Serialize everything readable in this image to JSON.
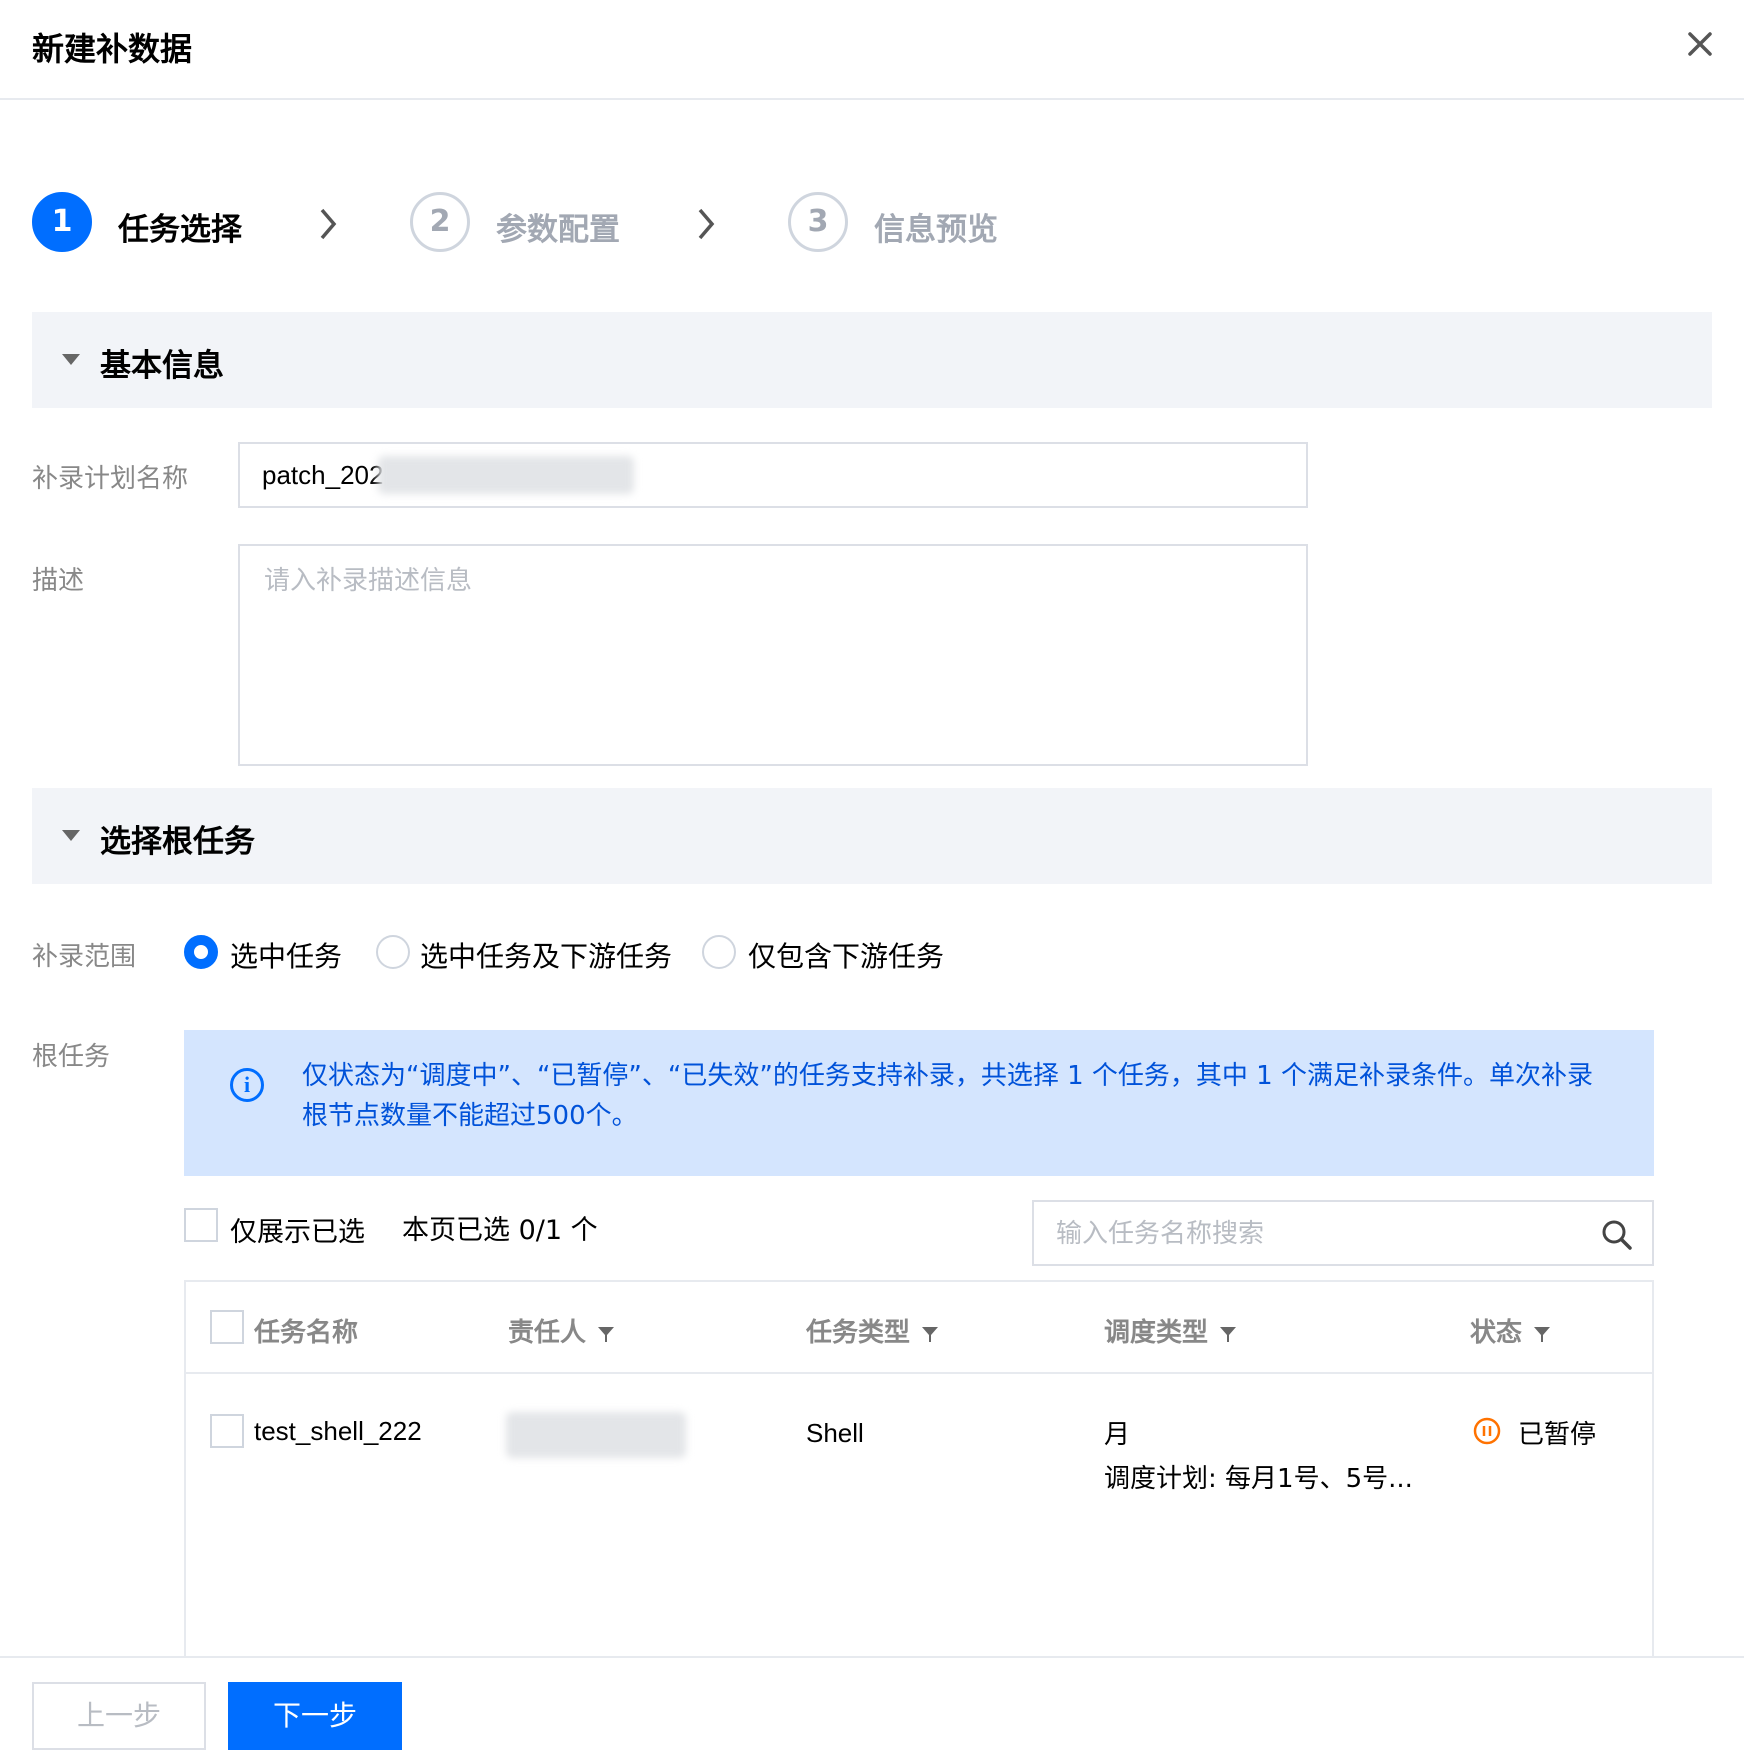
{
  "dialog": {
    "title": "新建补数据"
  },
  "steps": [
    {
      "number": "1",
      "label": "任务选择"
    },
    {
      "number": "2",
      "label": "参数配置"
    },
    {
      "number": "3",
      "label": "信息预览"
    }
  ],
  "basic_info": {
    "section_title": "基本信息",
    "plan_name_label": "补录计划名称",
    "plan_name_value": "patch_202",
    "description_label": "描述",
    "description_placeholder": "请入补录描述信息"
  },
  "root_task": {
    "section_title": "选择根任务",
    "scope_label": "补录范围",
    "scope_options": [
      "选中任务",
      "选中任务及下游任务",
      "仅包含下游任务"
    ],
    "scope_selected": "选中任务",
    "root_label": "根任务",
    "notice": "仅状态为“调度中”、“已暂停”、“已失效”的任务支持补录，共选择 1 个任务，其中 1 个满足补录条件。单次补录根节点数量不能超过500个。",
    "show_selected_label": "仅展示已选",
    "page_selected_text": "本页已选 0/1 个",
    "search_placeholder": "输入任务名称搜索"
  },
  "table": {
    "headers": [
      "任务名称",
      "责任人",
      "任务类型",
      "调度类型",
      "状态"
    ],
    "rows": [
      {
        "name": "test_shell_222",
        "owner": "",
        "type": "Shell",
        "schedule_type": "月",
        "schedule_plan": "调度计划: 每月1号、5号...",
        "status": "已暂停"
      }
    ]
  },
  "footer": {
    "prev_label": "上一步",
    "next_label": "下一步"
  },
  "colors": {
    "primary": "#006eff",
    "paused": "#ff7200",
    "notice_bg": "#d4e5fe"
  }
}
